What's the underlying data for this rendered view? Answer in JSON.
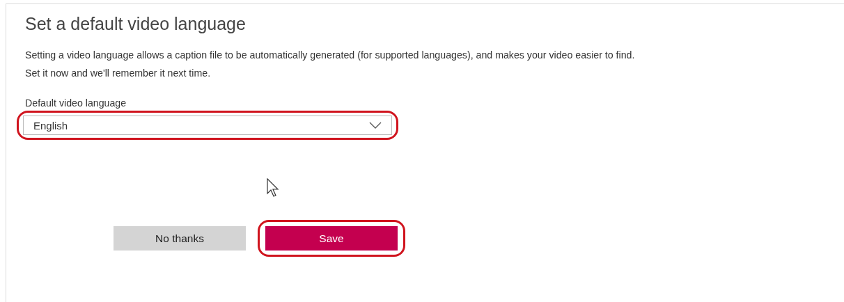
{
  "title": "Set a default video language",
  "description": [
    "Setting a video language allows a caption file to be automatically generated (for supported languages), and makes your video easier to find.",
    "Set it now and we'll remember it next time."
  ],
  "language_field": {
    "label": "Default video language",
    "value": "English",
    "highlighted": true
  },
  "buttons": [
    {
      "label": "No thanks",
      "kind": "secondary",
      "highlighted": false
    },
    {
      "label": "Save",
      "kind": "primary",
      "highlighted": true
    }
  ]
}
